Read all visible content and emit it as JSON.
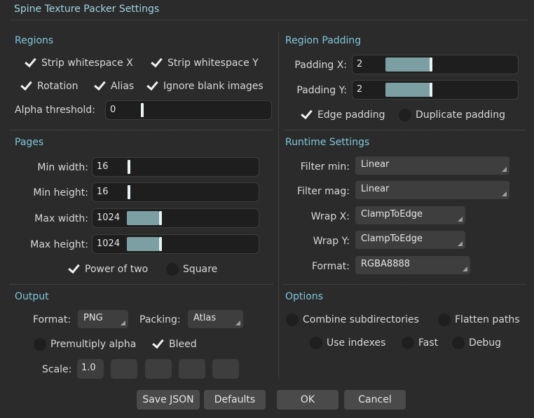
{
  "title": "Spine Texture Packer Settings",
  "regions": {
    "header": "Regions",
    "strip_x": "Strip whitespace X",
    "strip_y": "Strip whitespace Y",
    "rotation": "Rotation",
    "alias": "Alias",
    "ignore_blank": "Ignore blank images",
    "alpha_label": "Alpha threshold:",
    "alpha_value": "0",
    "checked": {
      "strip_x": true,
      "strip_y": true,
      "rotation": true,
      "alias": true,
      "ignore_blank": true
    }
  },
  "padding": {
    "header": "Region Padding",
    "x_label": "Padding X:",
    "x_value": "2",
    "y_label": "Padding Y:",
    "y_value": "2",
    "edge": "Edge padding",
    "duplicate": "Duplicate padding",
    "checked": {
      "edge": true,
      "duplicate": false
    }
  },
  "pages": {
    "header": "Pages",
    "min_width_label": "Min width:",
    "min_width": "16",
    "min_height_label": "Min height:",
    "min_height": "16",
    "max_width_label": "Max width:",
    "max_width": "1024",
    "max_height_label": "Max height:",
    "max_height": "1024",
    "pot": "Power of two",
    "square": "Square",
    "checked": {
      "pot": true,
      "square": false
    }
  },
  "runtime": {
    "header": "Runtime Settings",
    "filter_min_label": "Filter min:",
    "filter_min": "Linear",
    "filter_mag_label": "Filter mag:",
    "filter_mag": "Linear",
    "wrap_x_label": "Wrap X:",
    "wrap_x": "ClampToEdge",
    "wrap_y_label": "Wrap Y:",
    "wrap_y": "ClampToEdge",
    "format_label": "Format:",
    "format": "RGBA8888"
  },
  "output": {
    "header": "Output",
    "format_label": "Format:",
    "format": "PNG",
    "packing_label": "Packing:",
    "packing": "Atlas",
    "premultiply": "Premultiply alpha",
    "bleed": "Bleed",
    "scale_label": "Scale:",
    "scale_value": "1.0",
    "checked": {
      "premultiply": false,
      "bleed": true
    }
  },
  "options": {
    "header": "Options",
    "combine": "Combine subdirectories",
    "flatten": "Flatten paths",
    "use_indexes": "Use indexes",
    "fast": "Fast",
    "debug": "Debug",
    "checked": {
      "combine": false,
      "flatten": false,
      "use_indexes": false,
      "fast": false,
      "debug": false
    }
  },
  "buttons": {
    "save_json": "Save JSON",
    "defaults": "Defaults",
    "ok": "OK",
    "cancel": "Cancel"
  },
  "colors": {
    "background": "#2b2b2b",
    "section_header": "#7fc7dc",
    "slider_fill": "#7b9fa3"
  }
}
